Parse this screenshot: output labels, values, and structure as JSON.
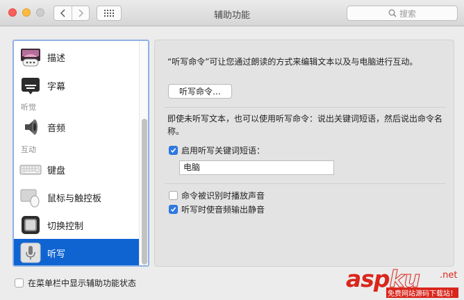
{
  "window": {
    "title": "辅助功能"
  },
  "toolbar": {
    "search_placeholder": "搜索"
  },
  "sidebar": {
    "items": [
      {
        "label": "描述"
      },
      {
        "label": "字幕"
      },
      {
        "label": "音频"
      },
      {
        "label": "键盘"
      },
      {
        "label": "鼠标与触控板"
      },
      {
        "label": "切换控制"
      },
      {
        "label": "听写",
        "selected": true
      }
    ],
    "sections": {
      "hearing": "听觉",
      "interaction": "互动"
    }
  },
  "main": {
    "description1": "“听写命令”可让您通过朗读的方式来编辑文本以及与电脑进行互动。",
    "dictation_commands_button": "听写命令…",
    "description2": "即使未听写文本，也可以使用听写命令：说出关键词短语，然后说出命令名称。",
    "enable_keyword_phrase": {
      "label": "启用听写关键词短语：",
      "checked": true
    },
    "keyword_phrase_value": "电脑",
    "play_sound": {
      "label": "命令被识别时播放声音",
      "checked": false
    },
    "mute_audio": {
      "label": "听写时使音频输出静音",
      "checked": true
    }
  },
  "footer": {
    "show_status_label": "在菜单栏中显示辅助功能状态",
    "checked": false
  },
  "watermark": {
    "brand_a": "asp",
    "brand_b": "ku",
    "brand_c": ".net",
    "tagline": "免费网站源码下载站！"
  },
  "colors": {
    "accent": "#0f64d2",
    "checkbox_on": "#2f7ae5",
    "watermark": "#d9261c"
  }
}
